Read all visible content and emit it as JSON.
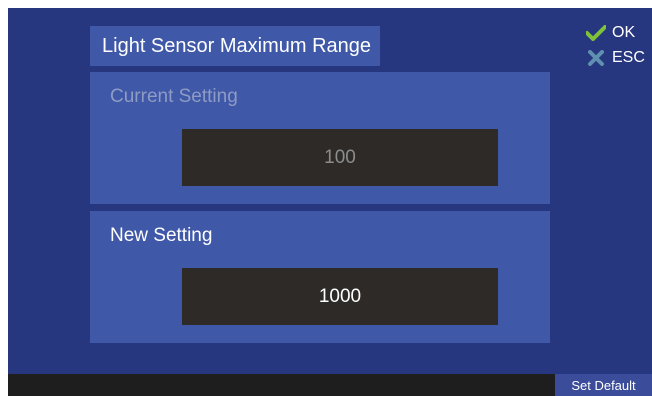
{
  "title": "Light Sensor Maximum Range",
  "current": {
    "label": "Current Setting",
    "value": "100"
  },
  "new_setting": {
    "label": "New Setting",
    "value": "1000"
  },
  "actions": {
    "ok_label": "OK",
    "esc_label": "ESC"
  },
  "bottom": {
    "set_default_label": "Set Default"
  },
  "colors": {
    "background": "#27377f",
    "panel": "#3f58a8",
    "value_box": "#2e2a27",
    "ok_icon": "#7ec23a",
    "esc_icon": "#5f90b0"
  },
  "icons": {
    "ok": "check-icon",
    "esc": "x-icon"
  }
}
